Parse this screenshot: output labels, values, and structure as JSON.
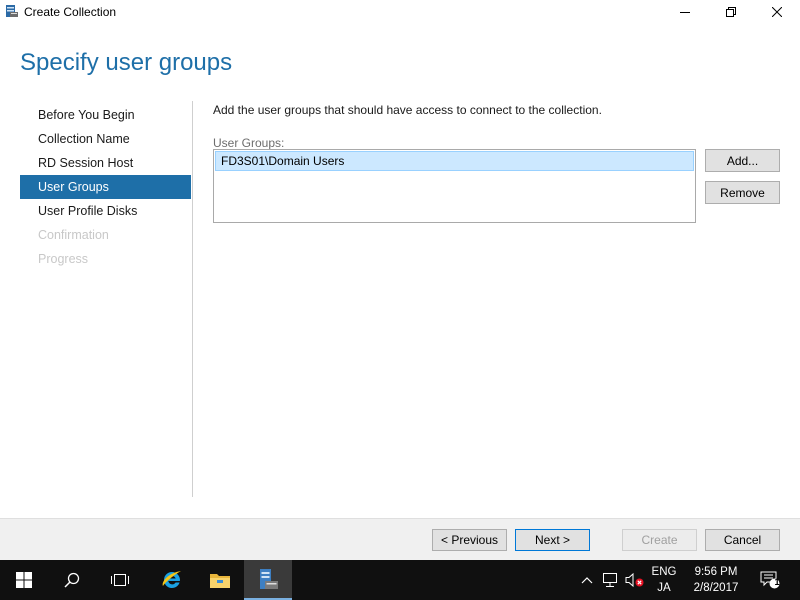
{
  "window": {
    "title": "Create Collection",
    "icon": "server-manager-icon"
  },
  "page": {
    "title": "Specify user groups"
  },
  "nav": {
    "items": [
      {
        "label": "Before You Begin",
        "state": "normal"
      },
      {
        "label": "Collection Name",
        "state": "normal"
      },
      {
        "label": "RD Session Host",
        "state": "normal"
      },
      {
        "label": "User Groups",
        "state": "selected"
      },
      {
        "label": "User Profile Disks",
        "state": "normal"
      },
      {
        "label": "Confirmation",
        "state": "disabled"
      },
      {
        "label": "Progress",
        "state": "disabled"
      }
    ]
  },
  "content": {
    "instruction": "Add the user groups that should have access to connect to the collection.",
    "user_groups_label": "User Groups:",
    "user_groups": [
      "FD3S01\\Domain Users"
    ],
    "add_label": "Add...",
    "remove_label": "Remove"
  },
  "footer": {
    "previous_label": "< Previous",
    "next_label": "Next >",
    "create_label": "Create",
    "cancel_label": "Cancel"
  },
  "taskbar": {
    "language": "ENG",
    "input_mode": "JA",
    "time": "9:56 PM",
    "date": "2/8/2017",
    "notification_count": "1"
  },
  "colors": {
    "accent": "#1e6fa8",
    "selection": "#cce8ff",
    "taskbar": "#101010"
  }
}
